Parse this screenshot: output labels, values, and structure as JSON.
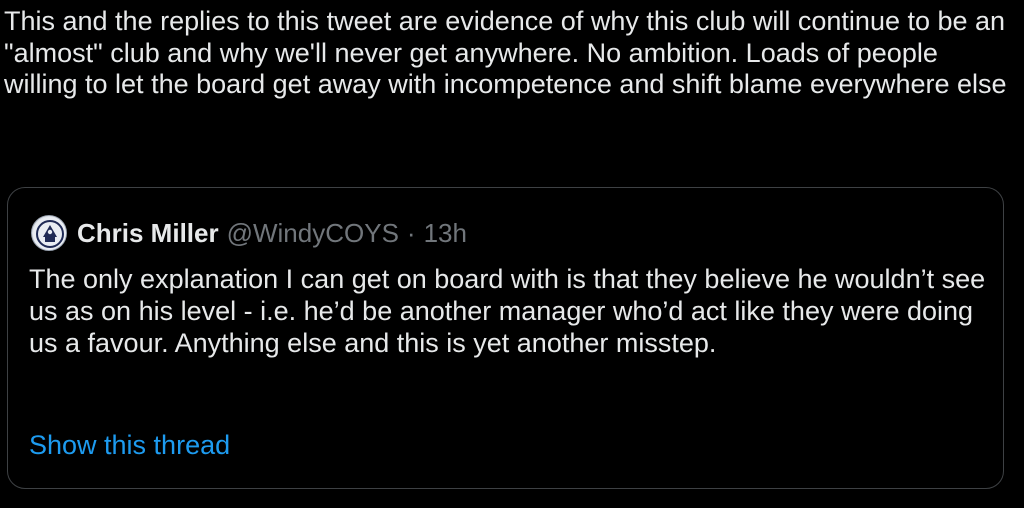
{
  "tweet": {
    "text": "This and the replies to this tweet are evidence of why this club will continue to be an \"almost\" club and why we'll never get anywhere. No ambition. Loads of people willing to let the board get away with incompetence and shift blame everywhere else"
  },
  "quoted_tweet": {
    "author_name": "Chris Miller",
    "author_handle": "@WindyCOYS",
    "separator": "·",
    "time": "13h",
    "avatar_icon": "club-crest-avatar",
    "text": "The only explanation I can get on board with is that they believe he wouldn’t see us as on his level - i.e. he’d be another manager who’d act like they were doing us a favour. Anything else and this is yet another misstep.",
    "show_thread_label": "Show this thread"
  },
  "colors": {
    "background": "#000000",
    "text_primary": "#e7e9ea",
    "text_secondary": "#71767b",
    "link": "#1d9bf0",
    "card_border": "#3e4144"
  }
}
